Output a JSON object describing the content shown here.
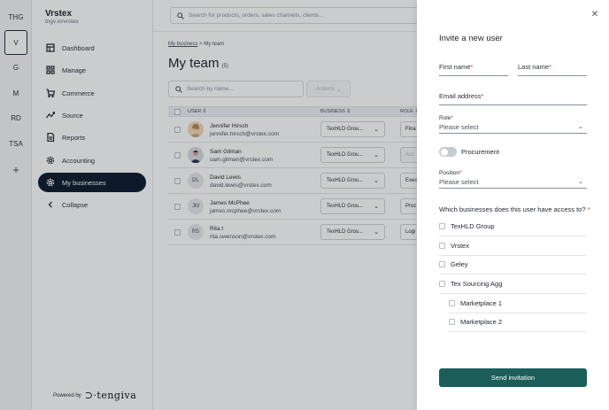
{
  "workspaces": [
    {
      "label": "THG",
      "active": false
    },
    {
      "label": "V",
      "active": true
    },
    {
      "label": "G",
      "active": false
    },
    {
      "label": "M",
      "active": false
    },
    {
      "label": "RD",
      "active": false
    },
    {
      "label": "TSA",
      "active": false
    }
  ],
  "workspace_add": "+",
  "sidebar": {
    "brand": "Vrstex",
    "url": "tngv.io/vrstex",
    "items": [
      {
        "label": "Dashboard",
        "icon": "dashboard-icon"
      },
      {
        "label": "Manage",
        "icon": "grid-icon"
      },
      {
        "label": "Commerce",
        "icon": "cart-icon"
      },
      {
        "label": "Source",
        "icon": "source-icon"
      },
      {
        "label": "Reports",
        "icon": "document-icon"
      },
      {
        "label": "Accounting",
        "icon": "gear-icon"
      },
      {
        "label": "My businesses",
        "icon": "gear-icon",
        "active": true
      },
      {
        "label": "Collapse",
        "icon": "chevron-left-icon"
      }
    ],
    "powered_by": "Powered by",
    "logo": "tengiva"
  },
  "main": {
    "search_placeholder": "Search for products, orders, sales channels, clients...",
    "breadcrumb": {
      "parent": "My business",
      "separator": ">",
      "current": "My team"
    },
    "title": "My team",
    "count": "(5)",
    "filter_placeholder": "Search by name...",
    "actions_label": "Actions",
    "columns": {
      "user": "USER ⇕",
      "business": "BUSINESS ⇕",
      "role": "ROLE ⇕"
    },
    "rows": [
      {
        "initials": "",
        "photo": true,
        "name": "Jennifer Hirsch",
        "email": "jennifer.hirsch@vrstex.com",
        "business": "TexHLD Grou...",
        "role": "Fina",
        "role_disabled": false
      },
      {
        "initials": "",
        "photo": true,
        "name": "Sam Gilman",
        "email": "sam.gilman@vrstex.com",
        "business": "TexHLD Grou...",
        "role": "Acc",
        "role_disabled": true
      },
      {
        "initials": "DL",
        "photo": false,
        "name": "David Lewis",
        "email": "david.lewis@vrstex.com",
        "business": "TexHLD Grou...",
        "role": "Exec",
        "role_disabled": false
      },
      {
        "initials": "JM",
        "photo": false,
        "name": "James McPhee",
        "email": "james.mcphee@vrstex.com",
        "business": "TexHLD Grou...",
        "role": "Proc",
        "role_disabled": false
      },
      {
        "initials": "RS",
        "photo": false,
        "name": "Rita t",
        "email": "rita.swenson@vrstex.com",
        "business": "TexHLD Grou...",
        "role": "Logi",
        "role_disabled": false
      }
    ]
  },
  "drawer": {
    "title": "Invite a new user",
    "first_name_label": "First name",
    "last_name_label": "Last name",
    "email_label": "Email address",
    "required_mark": "*",
    "role_label": "Role",
    "role_value": "Please select",
    "procurement_label": "Procurement",
    "procurement_on": false,
    "position_label": "Position",
    "position_value": "Please select",
    "businesses_question": "Which businesses does this user have access to?",
    "businesses": [
      {
        "label": "TexHLD Group",
        "sub": false
      },
      {
        "label": "Vrstex",
        "sub": false
      },
      {
        "label": "Geley",
        "sub": false
      },
      {
        "label": "Tex Sourcing Agg",
        "sub": false
      },
      {
        "label": "Marketplace 1",
        "sub": true
      },
      {
        "label": "Marketplace 2",
        "sub": true
      }
    ],
    "send_label": "Send invitation"
  },
  "colors": {
    "active_nav": "#0d1b2e",
    "primary_button": "#1b5e5a",
    "required": "#d32f2f"
  }
}
